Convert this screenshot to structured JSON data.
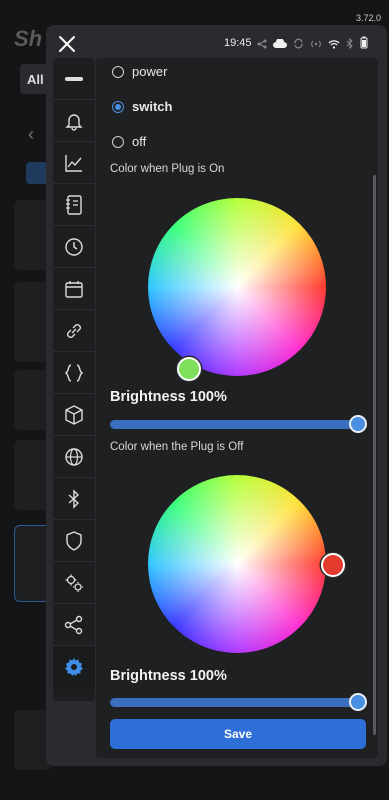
{
  "app": {
    "version": "3.72.0"
  },
  "background": {
    "tab_all": "All"
  },
  "status": {
    "time": "19:45"
  },
  "radio_options": [
    {
      "label": "power",
      "checked": false
    },
    {
      "label": "switch",
      "checked": true
    },
    {
      "label": "off",
      "checked": false
    }
  ],
  "on_section": {
    "label": "Color when Plug is On",
    "brightness_label": "Brightness 100%",
    "brightness": 100,
    "color": "#7ee05a"
  },
  "off_section": {
    "label": "Color when the Plug is Off",
    "brightness_label": "Brightness 100%",
    "brightness": 100,
    "color": "#e23b2d"
  },
  "save_label": "Save",
  "sidebar_icons": [
    "device-icon",
    "bell-icon",
    "chart-icon",
    "notebook-icon",
    "clock-icon",
    "calendar-icon",
    "link-icon",
    "code-braces-icon",
    "cube-icon",
    "globe-icon",
    "bluetooth-icon",
    "shield-icon",
    "gears-icon",
    "share-icon",
    "settings-icon"
  ],
  "accent": "#4a90e2"
}
